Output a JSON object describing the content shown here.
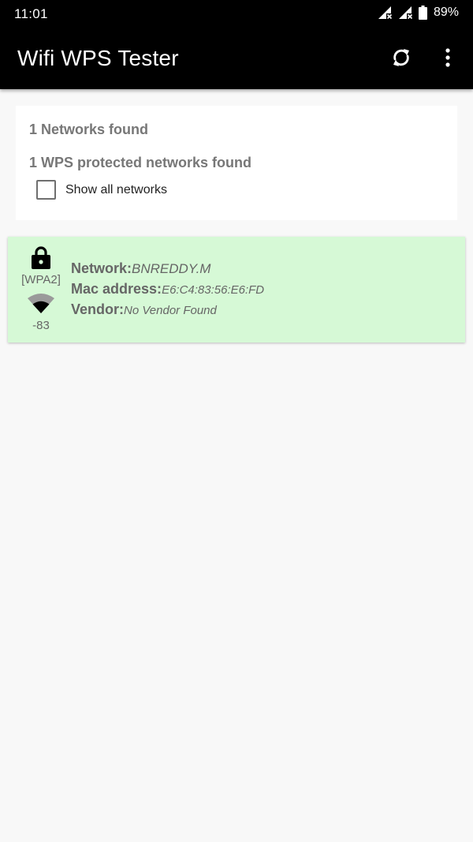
{
  "status_bar": {
    "time": "11:01",
    "battery": "89%",
    "icons": [
      "signal-no-service-icon",
      "signal-no-service-icon",
      "battery-icon"
    ]
  },
  "app_bar": {
    "title": "Wifi WPS Tester",
    "actions": [
      "refresh-icon",
      "more-vert-icon"
    ]
  },
  "summary": {
    "networks_found": "1 Networks found",
    "wps_found": "1 WPS protected networks found",
    "show_all_label": "Show all networks",
    "show_all_checked": false
  },
  "networks": [
    {
      "security": "[WPA2]",
      "signal": "-83",
      "network_label": "Network:",
      "network_value": "BNREDDY.M",
      "mac_label": "Mac address:",
      "mac_value": "E6:C4:83:56:E6:FD",
      "vendor_label": "Vendor:",
      "vendor_value": "No Vendor Found",
      "row_color": "#d6f9d6"
    }
  ],
  "colors": {
    "app_bar": "#000000",
    "background": "#f8f8f8",
    "card": "#ffffff",
    "network_row": "#d6f9d6"
  }
}
